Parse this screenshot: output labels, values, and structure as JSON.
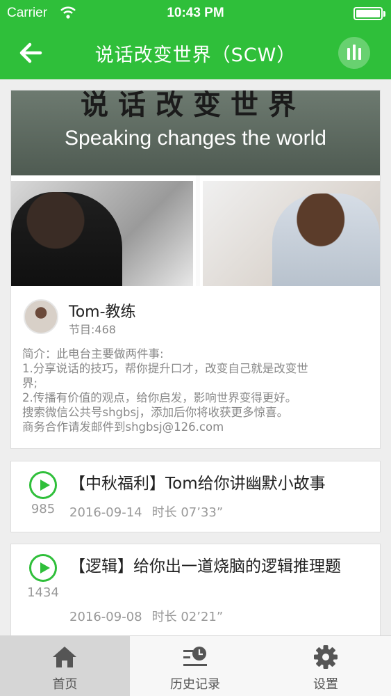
{
  "status_bar": {
    "carrier": "Carrier",
    "time": "10:43 PM"
  },
  "nav": {
    "title": "说话改变世界（SCW）",
    "back_icon": "back-arrow-icon",
    "stats_icon": "bar-chart-icon"
  },
  "banner": {
    "calligraphy": "说话改变世界",
    "english_slogan": "Speaking changes the world"
  },
  "channel": {
    "coach_name": "Tom-教练",
    "episode_count": "节目:468",
    "intro_lines": [
      "简介：此电台主要做两件事:",
      "1.分享说话的技巧，帮你提升口才，改变自己就是改变世",
      "界;",
      "2.传播有价值的观点，给你启发，影响世界变得更好。",
      "搜索微信公共号shgbsj，添加后你将收获更多惊喜。",
      "商务合作请发邮件到shgbsj@126.com"
    ]
  },
  "episodes": [
    {
      "title": "【中秋福利】Tom给你讲幽默小故事",
      "plays": "985",
      "date": "2016-09-14",
      "duration": "时长 07’33”"
    },
    {
      "title": "【逻辑】给你出一道烧脑的逻辑推理题",
      "plays": "1434",
      "date": "2016-09-08",
      "duration": "时长 02’21”"
    }
  ],
  "tabs": [
    {
      "label": "首页",
      "icon": "home-icon",
      "active": true
    },
    {
      "label": "历史记录",
      "icon": "history-icon",
      "active": false
    },
    {
      "label": "设置",
      "icon": "gear-icon",
      "active": false
    }
  ],
  "colors": {
    "brand_green": "#2fbf3a",
    "background": "#eeeeee"
  }
}
